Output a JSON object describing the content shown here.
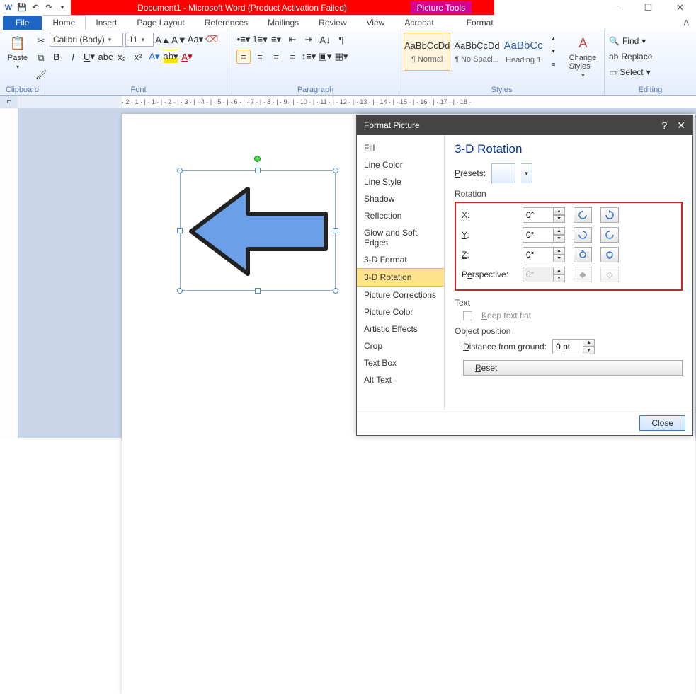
{
  "titlebar": {
    "title": "Document1  -  Microsoft Word (Product Activation Failed)",
    "contextual_tab": "Picture Tools"
  },
  "tabs": {
    "file": "File",
    "home": "Home",
    "insert": "Insert",
    "page_layout": "Page Layout",
    "references": "References",
    "mailings": "Mailings",
    "review": "Review",
    "view": "View",
    "acrobat": "Acrobat",
    "format": "Format"
  },
  "ribbon": {
    "clipboard": {
      "label": "Clipboard",
      "paste": "Paste"
    },
    "font": {
      "label": "Font",
      "name": "Calibri (Body)",
      "size": "11"
    },
    "paragraph": {
      "label": "Paragraph"
    },
    "styles": {
      "label": "Styles",
      "items": [
        {
          "preview": "AaBbCcDd",
          "name": "¶ Normal"
        },
        {
          "preview": "AaBbCcDd",
          "name": "¶ No Spaci..."
        },
        {
          "preview": "AaBbCc",
          "name": "Heading 1"
        }
      ],
      "change": "Change Styles"
    },
    "editing": {
      "label": "Editing",
      "find": "Find",
      "replace": "Replace",
      "select": "Select"
    }
  },
  "dialog": {
    "title": "Format Picture",
    "nav": [
      "Fill",
      "Line Color",
      "Line Style",
      "Shadow",
      "Reflection",
      "Glow and Soft Edges",
      "3-D Format",
      "3-D Rotation",
      "Picture Corrections",
      "Picture Color",
      "Artistic Effects",
      "Crop",
      "Text Box",
      "Alt Text"
    ],
    "nav_selected_index": 7,
    "pane": {
      "heading": "3-D Rotation",
      "presets_label": "Presets:",
      "rotation_label": "Rotation",
      "x_label": "X:",
      "y_label": "Y:",
      "z_label": "Z:",
      "persp_label": "Perspective:",
      "x_value": "0°",
      "y_value": "0°",
      "z_value": "0°",
      "persp_value": "0°",
      "text_label": "Text",
      "keep_flat": "Keep text flat",
      "objpos_label": "Object position",
      "distance_label": "Distance from ground:",
      "distance_value": "0 pt",
      "reset": "Reset"
    },
    "close": "Close"
  }
}
